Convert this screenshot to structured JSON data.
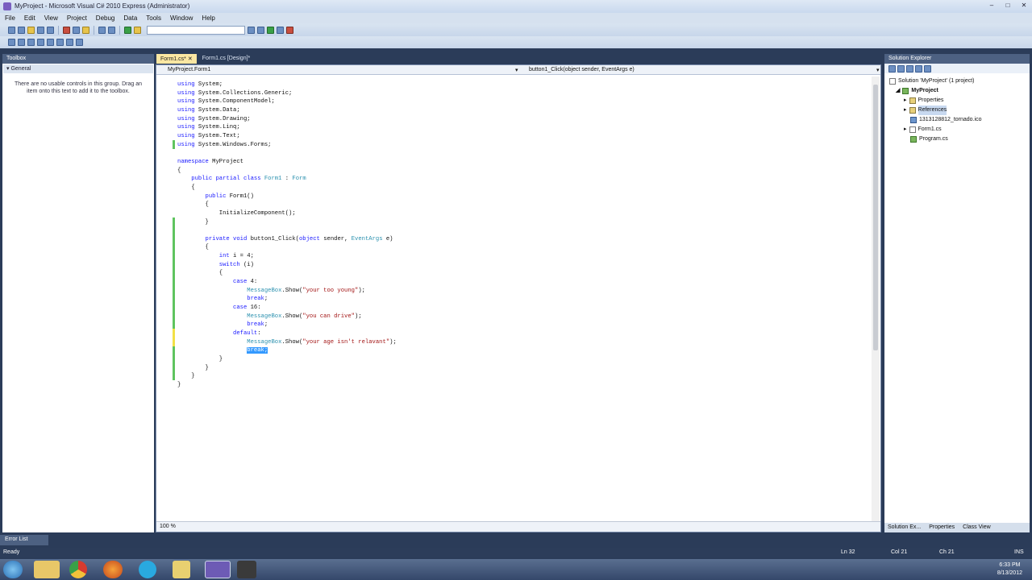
{
  "window": {
    "title": "MyProject - Microsoft Visual C# 2010 Express (Administrator)"
  },
  "menu": [
    "File",
    "Edit",
    "View",
    "Project",
    "Debug",
    "Data",
    "Tools",
    "Window",
    "Help"
  ],
  "toolbox": {
    "header": "Toolbox",
    "group": "General",
    "message": "There are no usable controls in this group. Drag an item onto this text to add it to the toolbox."
  },
  "tabs": [
    "Form1.cs*",
    "Form1.cs [Design]*"
  ],
  "navbar": {
    "left": "MyProject.Form1",
    "right": "button1_Click(object sender, EventArgs e)"
  },
  "code": [
    [
      {
        "t": "using",
        "c": "kw"
      },
      {
        "t": " System;"
      }
    ],
    [
      {
        "t": "using",
        "c": "kw"
      },
      {
        "t": " System.Collections.Generic;"
      }
    ],
    [
      {
        "t": "using",
        "c": "kw"
      },
      {
        "t": " System.ComponentModel;"
      }
    ],
    [
      {
        "t": "using",
        "c": "kw"
      },
      {
        "t": " System.Data;"
      }
    ],
    [
      {
        "t": "using",
        "c": "kw"
      },
      {
        "t": " System.Drawing;"
      }
    ],
    [
      {
        "t": "using",
        "c": "kw"
      },
      {
        "t": " System.Linq;"
      }
    ],
    [
      {
        "t": "using",
        "c": "kw"
      },
      {
        "t": " System.Text;"
      }
    ],
    [
      {
        "t": "using",
        "c": "kw"
      },
      {
        "t": " System.Windows.Forms;"
      }
    ],
    [],
    [
      {
        "t": "namespace",
        "c": "kw"
      },
      {
        "t": " MyProject"
      }
    ],
    [
      {
        "t": "{"
      }
    ],
    [
      {
        "t": "    "
      },
      {
        "t": "public partial class",
        "c": "kw"
      },
      {
        "t": " "
      },
      {
        "t": "Form1",
        "c": "ty"
      },
      {
        "t": " : "
      },
      {
        "t": "Form",
        "c": "ty"
      }
    ],
    [
      {
        "t": "    {"
      }
    ],
    [
      {
        "t": "        "
      },
      {
        "t": "public",
        "c": "kw"
      },
      {
        "t": " Form1()"
      }
    ],
    [
      {
        "t": "        {"
      }
    ],
    [
      {
        "t": "            InitializeComponent();"
      }
    ],
    [
      {
        "t": "        }"
      }
    ],
    [],
    [
      {
        "t": "        "
      },
      {
        "t": "private void",
        "c": "kw"
      },
      {
        "t": " button1_Click("
      },
      {
        "t": "object",
        "c": "kw"
      },
      {
        "t": " sender, "
      },
      {
        "t": "EventArgs",
        "c": "ty"
      },
      {
        "t": " e)"
      }
    ],
    [
      {
        "t": "        {"
      }
    ],
    [
      {
        "t": "            "
      },
      {
        "t": "int",
        "c": "kw"
      },
      {
        "t": " i = 4;"
      }
    ],
    [
      {
        "t": "            "
      },
      {
        "t": "switch",
        "c": "kw"
      },
      {
        "t": " (i)"
      }
    ],
    [
      {
        "t": "            {"
      }
    ],
    [
      {
        "t": "                "
      },
      {
        "t": "case",
        "c": "kw"
      },
      {
        "t": " 4:"
      }
    ],
    [
      {
        "t": "                    "
      },
      {
        "t": "MessageBox",
        "c": "ty"
      },
      {
        "t": ".Show("
      },
      {
        "t": "\"your too young\"",
        "c": "st"
      },
      {
        "t": ");"
      }
    ],
    [
      {
        "t": "                    "
      },
      {
        "t": "break",
        "c": "kw"
      },
      {
        "t": ";"
      }
    ],
    [
      {
        "t": "                "
      },
      {
        "t": "case",
        "c": "kw"
      },
      {
        "t": " 16:"
      }
    ],
    [
      {
        "t": "                    "
      },
      {
        "t": "MessageBox",
        "c": "ty"
      },
      {
        "t": ".Show("
      },
      {
        "t": "\"you can drive\"",
        "c": "st"
      },
      {
        "t": ");"
      }
    ],
    [
      {
        "t": "                    "
      },
      {
        "t": "break",
        "c": "kw"
      },
      {
        "t": ";"
      }
    ],
    [
      {
        "t": "                "
      },
      {
        "t": "default",
        "c": "kw"
      },
      {
        "t": ":"
      }
    ],
    [
      {
        "t": "                    "
      },
      {
        "t": "MessageBox",
        "c": "ty"
      },
      {
        "t": ".Show("
      },
      {
        "t": "\"your age isn't relavant\"",
        "c": "st"
      },
      {
        "t": ");"
      }
    ],
    [
      {
        "t": "                    "
      },
      {
        "t": "break;",
        "c": "sel"
      }
    ],
    [
      {
        "t": "            }"
      }
    ],
    [
      {
        "t": "        }"
      }
    ],
    [
      {
        "t": "    }"
      }
    ],
    [
      {
        "t": "}"
      }
    ]
  ],
  "zoom": "100 %",
  "solution_explorer": {
    "header": "Solution Explorer",
    "items": [
      {
        "label": "Solution 'MyProject' (1 project)",
        "icon": "solution-icon"
      },
      {
        "label": "MyProject",
        "icon": "project-icon"
      },
      {
        "label": "Properties",
        "icon": "properties-icon"
      },
      {
        "label": "References",
        "icon": "references-icon"
      },
      {
        "label": "1313128812_tornado.ico",
        "icon": "ico-file-icon"
      },
      {
        "label": "Form1.cs",
        "icon": "form-icon"
      },
      {
        "label": "Program.cs",
        "icon": "csharp-file-icon"
      }
    ],
    "bottom_tabs": [
      "Solution Ex...",
      "Properties",
      "Class View"
    ]
  },
  "error_list": "Error List",
  "status": {
    "ready": "Ready",
    "ln": "Ln 32",
    "col": "Col 21",
    "ch": "Ch 21",
    "ins": "INS"
  },
  "clock": {
    "time": "6:33 PM",
    "date": "8/13/2012"
  },
  "taskbar": [
    "start-orb-icon",
    "file-explorer-icon",
    "chrome-icon",
    "firefox-icon",
    "skype-icon",
    "app-icon",
    "visual-studio-icon",
    "app-icon-2"
  ]
}
